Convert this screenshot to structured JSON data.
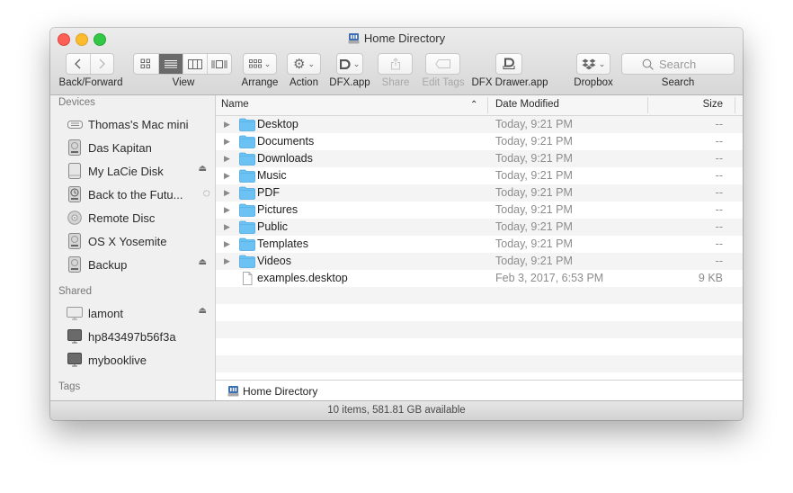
{
  "window": {
    "title": "Home Directory",
    "title_icon": "home-drive-icon"
  },
  "toolbar": {
    "back_forward_label": "Back/Forward",
    "view_label": "View",
    "view_modes": [
      "icon-view",
      "list-view",
      "column-view",
      "cover-flow-view"
    ],
    "active_view": "list-view",
    "arrange_label": "Arrange",
    "action_label": "Action",
    "dfx_label": "DFX.app",
    "share_label": "Share",
    "edit_tags_label": "Edit Tags",
    "dfx_drawer_label": "DFX Drawer.app",
    "dropbox_label": "Dropbox",
    "search_label": "Search",
    "search_placeholder": "Search"
  },
  "sidebar": {
    "devices_header": "Devices",
    "devices": [
      {
        "label": "Thomas's Mac mini",
        "icon": "mac-mini-icon",
        "eject": false
      },
      {
        "label": "Das Kapitan",
        "icon": "hard-drive-icon",
        "eject": false
      },
      {
        "label": "My LaCie Disk",
        "icon": "external-drive-icon",
        "eject": true
      },
      {
        "label": "Back to the Futu...",
        "icon": "time-machine-icon",
        "eject": false,
        "busy": true
      },
      {
        "label": "Remote Disc",
        "icon": "optical-disc-icon",
        "eject": false
      },
      {
        "label": "OS X Yosemite",
        "icon": "hard-drive-icon",
        "eject": false
      },
      {
        "label": "Backup",
        "icon": "hard-drive-icon",
        "eject": true
      }
    ],
    "shared_header": "Shared",
    "shared": [
      {
        "label": "lamont",
        "icon": "display-icon",
        "eject": true
      },
      {
        "label": "hp843497b56f3a",
        "icon": "pc-display-icon",
        "eject": false
      },
      {
        "label": "mybooklive",
        "icon": "pc-display-icon",
        "eject": false
      }
    ],
    "tags_header": "Tags"
  },
  "list": {
    "columns": {
      "name": "Name",
      "date": "Date Modified",
      "size": "Size"
    },
    "sort_indicator": "^",
    "rows": [
      {
        "name": "Desktop",
        "date": "Today, 9:21 PM",
        "size": "--",
        "type": "folder"
      },
      {
        "name": "Documents",
        "date": "Today, 9:21 PM",
        "size": "--",
        "type": "folder"
      },
      {
        "name": "Downloads",
        "date": "Today, 9:21 PM",
        "size": "--",
        "type": "folder"
      },
      {
        "name": "Music",
        "date": "Today, 9:21 PM",
        "size": "--",
        "type": "folder"
      },
      {
        "name": "PDF",
        "date": "Today, 9:21 PM",
        "size": "--",
        "type": "folder"
      },
      {
        "name": "Pictures",
        "date": "Today, 9:21 PM",
        "size": "--",
        "type": "folder"
      },
      {
        "name": "Public",
        "date": "Today, 9:21 PM",
        "size": "--",
        "type": "folder"
      },
      {
        "name": "Templates",
        "date": "Today, 9:21 PM",
        "size": "--",
        "type": "folder"
      },
      {
        "name": "Videos",
        "date": "Today, 9:21 PM",
        "size": "--",
        "type": "folder"
      },
      {
        "name": "examples.desktop",
        "date": "Feb 3, 2017, 6:53 PM",
        "size": "9 KB",
        "type": "file"
      }
    ],
    "empty_rows": 5
  },
  "path_bar": {
    "label": "Home Directory"
  },
  "status_bar": {
    "text": "10 items, 581.81 GB available"
  },
  "colors": {
    "folder": "#6cc3f3",
    "active_view": "#6a6a6a",
    "close": "#fc5f57",
    "minimize": "#fdbb2e",
    "maximize": "#33c748"
  }
}
